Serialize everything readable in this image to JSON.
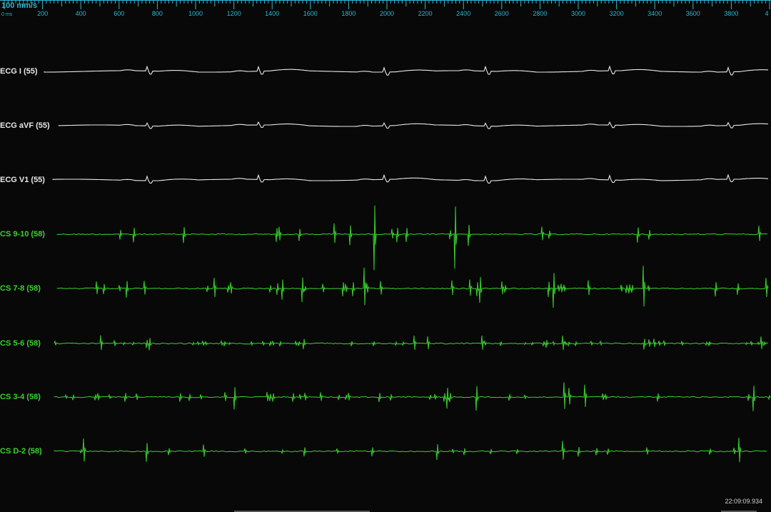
{
  "toolbar": {
    "speed_label": "100 mm/s",
    "zero_label": "0 ms",
    "ruler_ticks": [
      "200",
      "400",
      "600",
      "800",
      "1000",
      "1200",
      "1400",
      "1600",
      "1800",
      "2000",
      "2200",
      "2400",
      "2600",
      "2800",
      "3000",
      "3200",
      "3400",
      "3600",
      "3800",
      "4"
    ],
    "ruler_color": "#2fb6d0"
  },
  "channels": [
    {
      "label": "ECG I (55)",
      "type": "ecg",
      "color": "#e8e8e8"
    },
    {
      "label": "ECG aVF (55)",
      "type": "ecg",
      "color": "#e8e8e8"
    },
    {
      "label": "ECG V1 (55)",
      "type": "ecg",
      "color": "#e8e8e8"
    },
    {
      "label": "CS  9-10 (58)",
      "type": "cs",
      "color": "#38d42c"
    },
    {
      "label": "CS  7-8 (58)",
      "type": "cs",
      "color": "#38d42c"
    },
    {
      "label": "CS  5-6 (58)",
      "type": "cs",
      "color": "#38d42c"
    },
    {
      "label": "CS  3-4 (58)",
      "type": "cs",
      "color": "#38d42c"
    },
    {
      "label": "CS  D-2 (58)",
      "type": "cs",
      "color": "#38d42c"
    }
  ],
  "status": {
    "timestamp": "22:09:09.934"
  },
  "colors": {
    "background": "#080808",
    "ecg": "#e8e8e8",
    "cs": "#38d42c",
    "ruler": "#2fb6d0"
  }
}
